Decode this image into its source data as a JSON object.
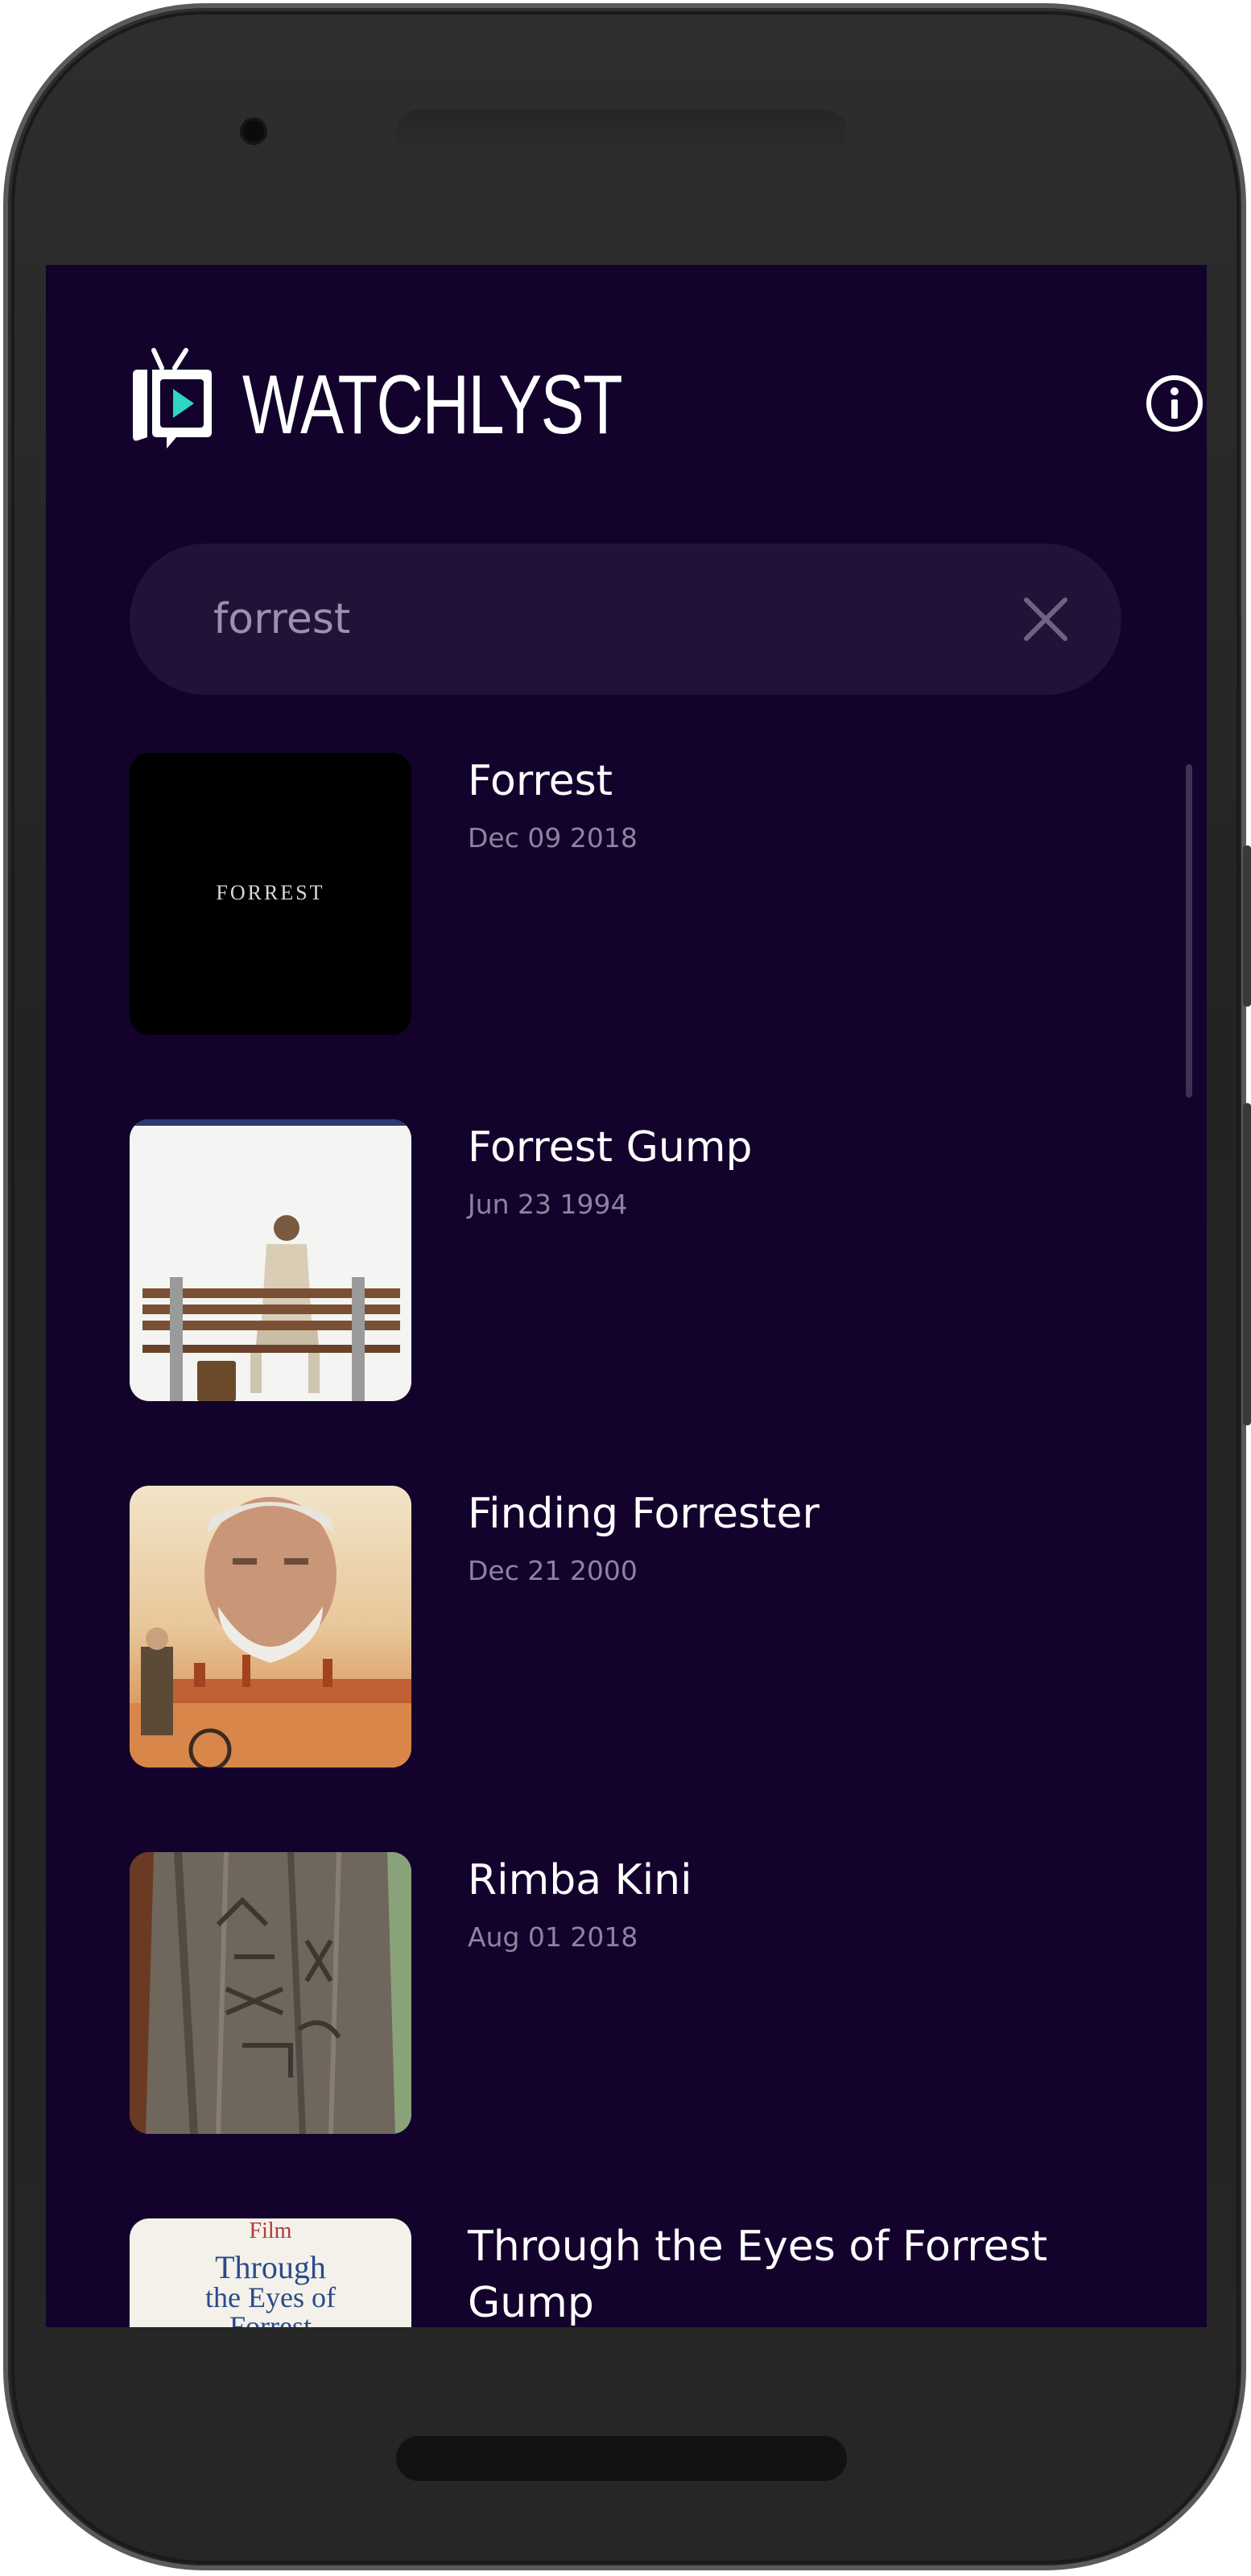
{
  "app": {
    "title": "WATCHLYST",
    "logo_icon": "tv-play-icon",
    "info_icon": "info-icon"
  },
  "search": {
    "value": "forrest",
    "clear_icon": "close-icon"
  },
  "results": [
    {
      "title": "Forrest",
      "date": "Dec 09 2018",
      "poster_text": "FORREST"
    },
    {
      "title": "Forrest Gump",
      "date": "Jun 23 1994"
    },
    {
      "title": "Finding Forrester",
      "date": "Dec 21 2000"
    },
    {
      "title": "Rimba Kini",
      "date": "Aug 01 2018"
    },
    {
      "title": "Through the Eyes of Forrest Gump",
      "date": "",
      "poster_text": [
        "Film",
        "Through",
        "the Eyes of",
        "Forrest"
      ]
    }
  ],
  "colors": {
    "background": "#12022c",
    "search_bg": "#221238",
    "accent": "#2fd6c5",
    "date_text": "#8e839f"
  }
}
